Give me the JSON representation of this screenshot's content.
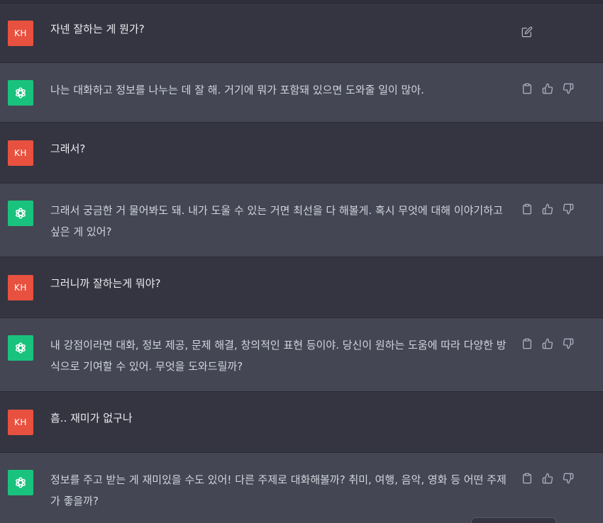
{
  "user": {
    "initials": "KH"
  },
  "colors": {
    "user_bg": "#343541",
    "assistant_bg": "#444654",
    "user_avatar": "#e8513f",
    "assistant_avatar": "#19c37d"
  },
  "messages": [
    {
      "role": "user",
      "text": "자넨 잘하는 게 뭔가?",
      "actions": [
        "edit-icon"
      ]
    },
    {
      "role": "assistant",
      "text": "나는 대화하고 정보를 나누는 데 잘 해. 거기에 뭐가 포함돼 있으면 도와줄 일이 많아.",
      "actions": [
        "clipboard-icon",
        "thumbs-up-icon",
        "thumbs-down-icon"
      ]
    },
    {
      "role": "user",
      "text": "그래서?",
      "actions": []
    },
    {
      "role": "assistant",
      "text": "그래서 궁금한 거 물어봐도 돼. 내가 도울 수 있는 거면 최선을 다 해볼게. 혹시 무엇에 대해 이야기하고 싶은 게 있어?",
      "actions": [
        "clipboard-icon",
        "thumbs-up-icon",
        "thumbs-down-icon"
      ]
    },
    {
      "role": "user",
      "text": "그러니까 잘하는게 뭐야?",
      "actions": []
    },
    {
      "role": "assistant",
      "text": "내 강점이라면 대화, 정보 제공, 문제 해결, 창의적인 표현 등이야. 당신이 원하는 도움에 따라 다양한 방식으로 기여할 수 있어. 무엇을 도와드릴까?",
      "actions": [
        "clipboard-icon",
        "thumbs-up-icon",
        "thumbs-down-icon"
      ]
    },
    {
      "role": "user",
      "text": "흠.. 재미가 없구나",
      "actions": []
    },
    {
      "role": "assistant",
      "text": "정보를 주고 받는 게 재미있을 수도 있어! 다른 주제로 대화해볼까? 취미, 여행, 음악, 영화 등 어떤 주제가 좋을까?",
      "actions": [
        "clipboard-icon",
        "thumbs-up-icon",
        "thumbs-down-icon"
      ]
    }
  ]
}
